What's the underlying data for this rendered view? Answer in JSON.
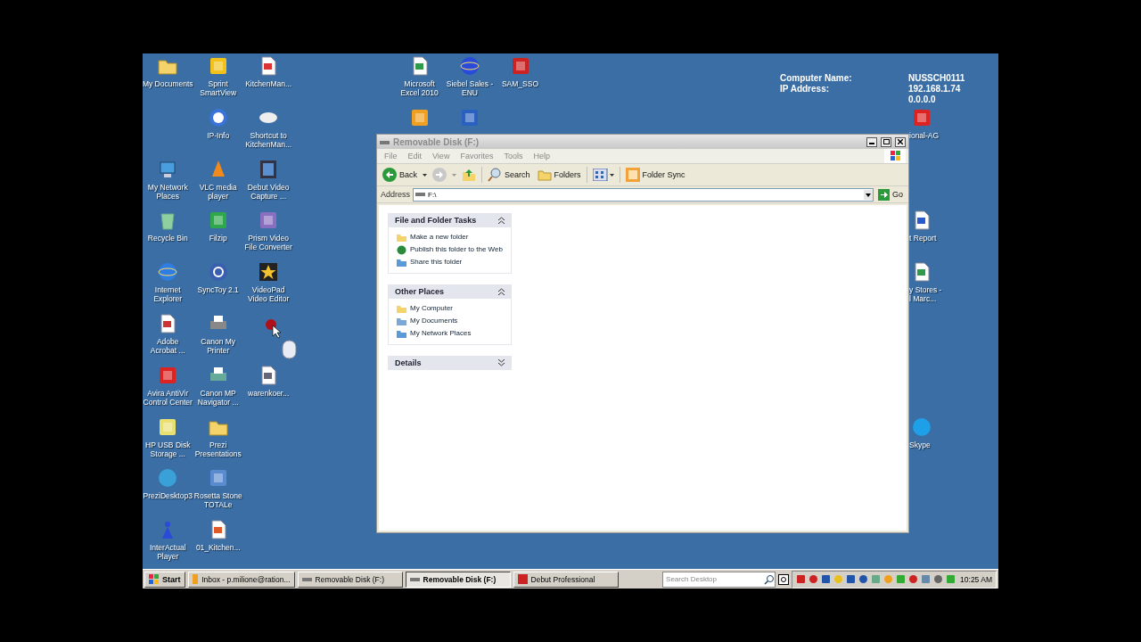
{
  "desktop_icons": [
    {
      "label": "My Documents",
      "clipped": false
    },
    {
      "label": "Sprint\nSmartView",
      "clipped": false
    },
    {
      "label": "KitchenMan...",
      "clipped": false
    },
    {
      "label": "IP-Info",
      "clipped": false
    },
    {
      "label": "Shortcut to\nKitchenMan...",
      "clipped": false
    },
    {
      "label": "My Network\nPlaces",
      "clipped": false
    },
    {
      "label": "VLC media\nplayer",
      "clipped": false
    },
    {
      "label": "Debut Video\nCapture ...",
      "clipped": false
    },
    {
      "label": "Recycle Bin",
      "clipped": false
    },
    {
      "label": "Filzip",
      "clipped": false
    },
    {
      "label": "Prism Video\nFile Converter",
      "clipped": false
    },
    {
      "label": "Internet\nExplorer",
      "clipped": false
    },
    {
      "label": "SyncToy 2.1",
      "clipped": false
    },
    {
      "label": "VideoPad\nVideo Editor",
      "clipped": false
    },
    {
      "label": "Adobe\nAcrobat ...",
      "clipped": false
    },
    {
      "label": "Canon My\nPrinter",
      "clipped": false
    },
    {
      "label": "Avira AntiVir\nControl Center",
      "clipped": false
    },
    {
      "label": "Canon MP\nNavigator ...",
      "clipped": false
    },
    {
      "label": "warenkoer...",
      "clipped": false
    },
    {
      "label": "HP USB Disk\nStorage ...",
      "clipped": false
    },
    {
      "label": "Prezi\nPresentations",
      "clipped": false
    },
    {
      "label": "PreziDesktop3",
      "clipped": false
    },
    {
      "label": "Rosetta Stone\nTOTALe",
      "clipped": false
    },
    {
      "label": "InterActual\nPlayer",
      "clipped": false
    },
    {
      "label": "01_Kitchen...",
      "clipped": false
    },
    {
      "label": "Microsoft\nExcel 2010",
      "clipped": false
    },
    {
      "label": "Siebel Sales -\nENU",
      "clipped": false
    },
    {
      "label": "SAM_SSO",
      "clipped": false
    },
    {
      "label": "ional-AG",
      "clipped": true
    },
    {
      "label": "t Report",
      "clipped": true
    },
    {
      "label": "y Stores -\nl Marc...",
      "clipped": true
    },
    {
      "label": "Skype",
      "clipped": true
    }
  ],
  "system_info": {
    "labels": [
      "Computer Name:",
      "IP Address:"
    ],
    "values": [
      "NUSSCH0111",
      "192.168.1.74",
      "0.0.0.0"
    ]
  },
  "window": {
    "title": "Removable Disk (F:)",
    "active": false,
    "menu": [
      "File",
      "Edit",
      "View",
      "Favorites",
      "Tools",
      "Help"
    ],
    "toolbar": {
      "back": "Back",
      "search": "Search",
      "folders": "Folders",
      "folder_sync": "Folder Sync"
    },
    "address": {
      "label": "Address",
      "value": "F:\\",
      "go": "Go"
    },
    "task_panes": [
      {
        "title": "File and Folder Tasks",
        "expanded": true,
        "items": [
          "Make a new folder",
          "Publish this folder to the Web",
          "Share this folder"
        ]
      },
      {
        "title": "Other Places",
        "expanded": true,
        "items": [
          "My Computer",
          "My Documents",
          "My Network Places"
        ]
      },
      {
        "title": "Details",
        "expanded": false
      }
    ]
  },
  "taskbar": {
    "start": "Start",
    "tasks": [
      {
        "label": "Inbox - p.milione@ration...",
        "selected": false
      },
      {
        "label": "Removable Disk (F:)",
        "selected": false
      },
      {
        "label": "Removable Disk (F:)",
        "selected": true
      },
      {
        "label": "Debut Professional",
        "selected": false
      }
    ],
    "search": {
      "placeholder": "Search Desktop"
    },
    "clock": "10:25 AM"
  }
}
